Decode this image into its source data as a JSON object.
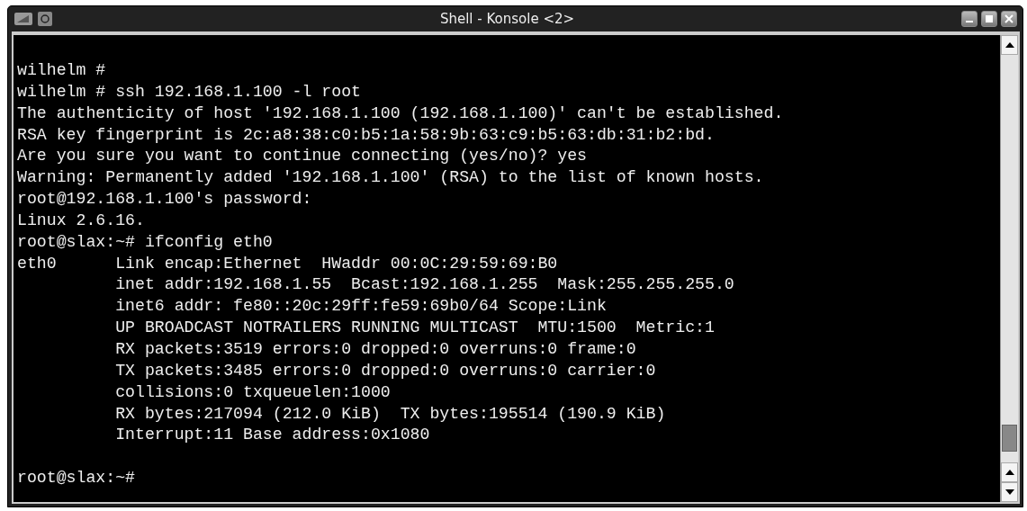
{
  "window": {
    "title": "Shell - Konsole <2>"
  },
  "terminal": {
    "lines": [
      "wilhelm #",
      "wilhelm # ssh 192.168.1.100 -l root",
      "The authenticity of host '192.168.1.100 (192.168.1.100)' can't be established.",
      "RSA key fingerprint is 2c:a8:38:c0:b5:1a:58:9b:63:c9:b5:63:db:31:b2:bd.",
      "Are you sure you want to continue connecting (yes/no)? yes",
      "Warning: Permanently added '192.168.1.100' (RSA) to the list of known hosts.",
      "root@192.168.1.100's password:",
      "Linux 2.6.16.",
      "root@slax:~# ifconfig eth0",
      "eth0      Link encap:Ethernet  HWaddr 00:0C:29:59:69:B0",
      "          inet addr:192.168.1.55  Bcast:192.168.1.255  Mask:255.255.255.0",
      "          inet6 addr: fe80::20c:29ff:fe59:69b0/64 Scope:Link",
      "          UP BROADCAST NOTRAILERS RUNNING MULTICAST  MTU:1500  Metric:1",
      "          RX packets:3519 errors:0 dropped:0 overruns:0 frame:0",
      "          TX packets:3485 errors:0 dropped:0 overruns:0 carrier:0",
      "          collisions:0 txqueuelen:1000",
      "          RX bytes:217094 (212.0 KiB)  TX bytes:195514 (190.9 KiB)",
      "          Interrupt:11 Base address:0x1080"
    ],
    "prompt": "root@slax:~#"
  }
}
